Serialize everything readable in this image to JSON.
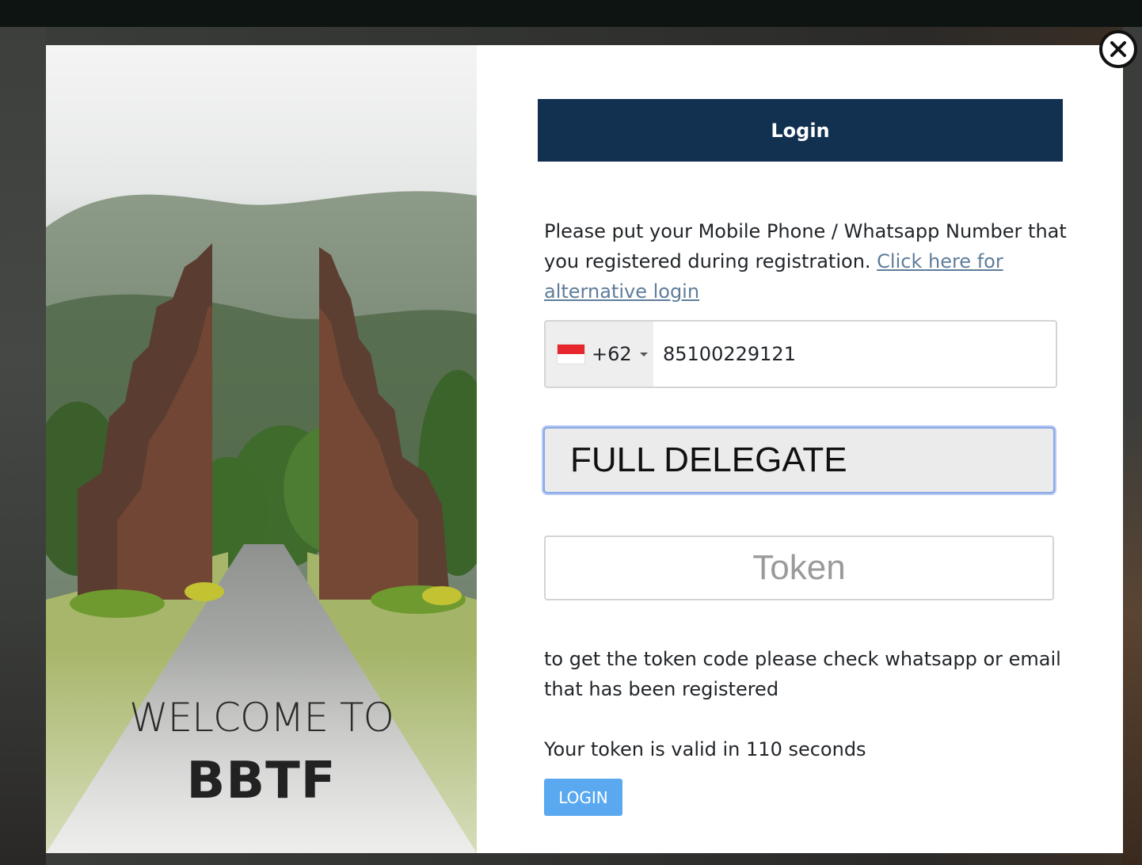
{
  "photo": {
    "welcome_line1": "WELCOME TO",
    "welcome_line2": "BBTF"
  },
  "form": {
    "header_title": "Login",
    "intro_text": "Please put your Mobile Phone / Whatsapp Number that you registered during registration. ",
    "alt_login_link": "Click here for alternative login",
    "phone": {
      "country_flag": "indonesia-flag",
      "dial_code": "+62",
      "number": "85100229121"
    },
    "delegate_type": "FULL DELEGATE",
    "token_placeholder": "Token",
    "token_hint": "to get the token code please check whatsapp or email that has been registered",
    "token_validity": "Your token is valid in 110 seconds",
    "login_button": "LOGIN"
  },
  "close_icon": "close-circle-icon",
  "colors": {
    "header_bg": "#12304f",
    "login_button_bg": "#5aa9f0",
    "link": "#5f7d9a",
    "focus_border": "#89a8e6"
  }
}
